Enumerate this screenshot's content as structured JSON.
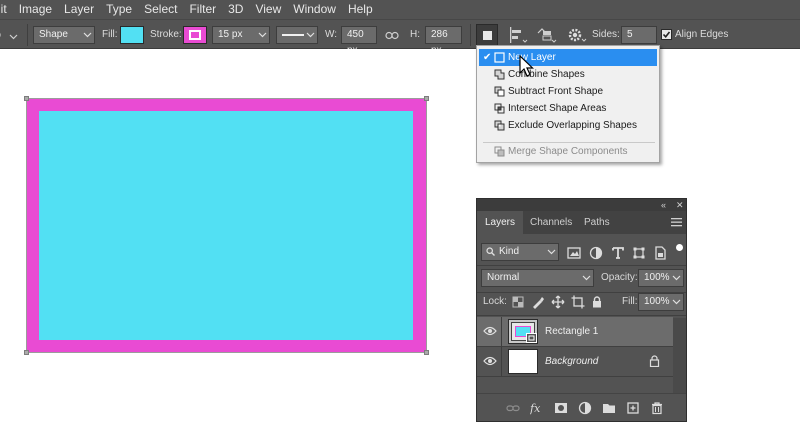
{
  "menubar": {
    "items": [
      "dit",
      "Image",
      "Layer",
      "Type",
      "Select",
      "Filter",
      "3D",
      "View",
      "Window",
      "Help"
    ]
  },
  "options": {
    "tool_mode": "Shape",
    "fill_label": "Fill:",
    "stroke_label": "Stroke:",
    "stroke_width": "15 px",
    "w_label": "W:",
    "w_value": "450 px",
    "h_label": "H:",
    "h_value": "286 px",
    "sides_label": "Sides:",
    "sides_value": "5",
    "align_edges_label": "Align Edges",
    "align_edges_checked": true
  },
  "colors": {
    "fill": "#52e0f3",
    "stroke": "#e94bd3",
    "ui_bg": "#535353",
    "selection": "#2a8ef0"
  },
  "path_operations_menu": {
    "items": [
      {
        "label": "New Layer",
        "icon": "new-layer-icon",
        "selected": true,
        "checked": true
      },
      {
        "label": "Combine Shapes",
        "icon": "combine-shapes-icon"
      },
      {
        "label": "Subtract Front Shape",
        "icon": "subtract-shape-icon"
      },
      {
        "label": "Intersect Shape Areas",
        "icon": "intersect-shapes-icon"
      },
      {
        "label": "Exclude Overlapping Shapes",
        "icon": "exclude-shapes-icon"
      }
    ],
    "disabled_item": {
      "label": "Merge Shape Components",
      "icon": "merge-components-icon"
    }
  },
  "layers_panel": {
    "tabs": [
      "Layers",
      "Channels",
      "Paths"
    ],
    "active_tab": "Layers",
    "filter_kind": "Kind",
    "blend_mode": "Normal",
    "opacity_label": "Opacity:",
    "opacity_value": "100%",
    "lock_label": "Lock:",
    "fill_label": "Fill:",
    "fill_value": "100%",
    "layers": [
      {
        "name": "Rectangle 1",
        "selected": true,
        "visible": true
      },
      {
        "name": "Background",
        "selected": false,
        "visible": true,
        "locked": true
      }
    ]
  }
}
